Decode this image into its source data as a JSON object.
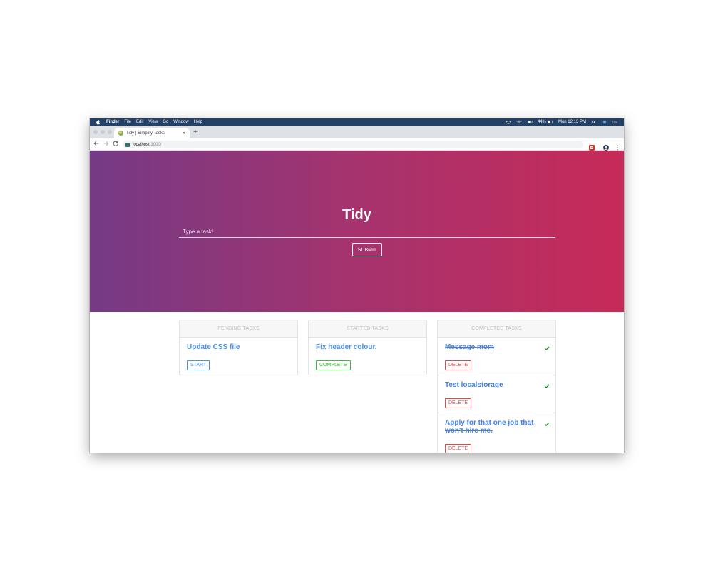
{
  "menubar": {
    "items": [
      "Finder",
      "File",
      "Edit",
      "View",
      "Go",
      "Window",
      "Help"
    ],
    "battery": "44%",
    "clock": "Mon 12:13 PM"
  },
  "browser": {
    "tab_title": "Tidy | Simplify Tasks!",
    "tab_close": "×",
    "new_tab": "+",
    "url_host": "localhost",
    "url_path": ":3000/"
  },
  "app": {
    "title": "Tidy",
    "input_placeholder": "Type a task!",
    "submit_label": "SUBMIT"
  },
  "columns": {
    "pending": {
      "header": "PENDING TASKS",
      "tasks": [
        {
          "title": "Update CSS file",
          "action": "START"
        }
      ]
    },
    "started": {
      "header": "STARTED TASKS",
      "tasks": [
        {
          "title": "Fix header colour.",
          "action": "COMPLETE"
        }
      ]
    },
    "completed": {
      "header": "COMPLETED TASKS",
      "tasks": [
        {
          "title": "Message mom",
          "action": "DELETE"
        },
        {
          "title": "Test localstorage",
          "action": "DELETE"
        },
        {
          "title": "Apply for that one job that won't hire me.",
          "action": "DELETE"
        }
      ]
    }
  },
  "colors": {
    "gradient_start": "#743a85",
    "gradient_end": "#c72a58",
    "link_blue": "#4a90e2",
    "complete_green": "#34c234",
    "delete_red": "#e24a4a"
  }
}
